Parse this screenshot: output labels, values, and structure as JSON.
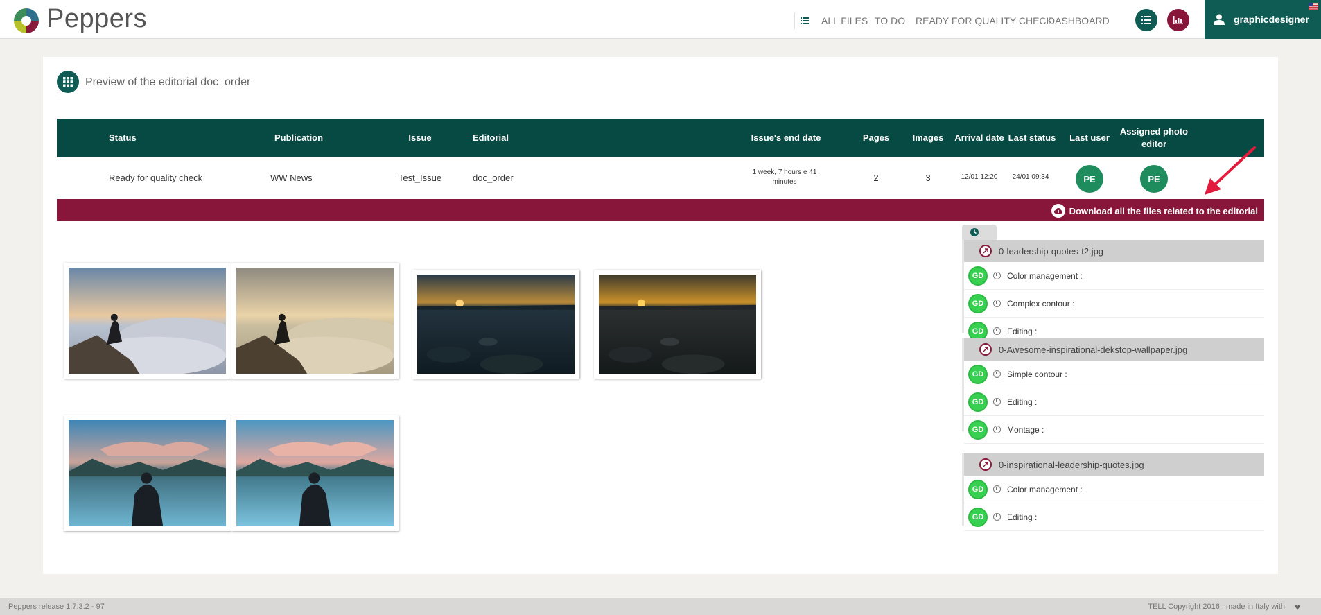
{
  "app": {
    "name": "Peppers"
  },
  "nav": {
    "items": [
      "ALL FILES",
      "TO DO",
      "READY FOR QUALITY CHECK",
      "DASHBOARD"
    ],
    "user": "graphicdesigner"
  },
  "page": {
    "title": "Preview of the editorial doc_order"
  },
  "table": {
    "headers": {
      "status": "Status",
      "publication": "Publication",
      "issue": "Issue",
      "editorial": "Editorial",
      "end_date": "Issue's end date",
      "pages": "Pages",
      "images": "Images",
      "arrival": "Arrival date",
      "last_status": "Last status",
      "last_user": "Last user",
      "assigned_line1": "Assigned photo",
      "assigned_line2": "editor"
    },
    "row": {
      "status": "Ready for quality check",
      "publication": "WW News",
      "issue": "Test_Issue",
      "editorial": "doc_order",
      "end_date_line1": "1 week, 7 hours e 41",
      "end_date_line2": "minutes",
      "pages": "2",
      "images": "3",
      "arrival": "12/01 12:20",
      "last_status": "24/01 09:34",
      "last_user": "PE",
      "assigned": "PE"
    }
  },
  "download": {
    "label": "Download all the files related to the editorial"
  },
  "files": [
    {
      "name": "0-leadership-quotes-t2.jpg",
      "tasks": [
        "Color management :",
        "Complex contour :",
        "Editing :"
      ]
    },
    {
      "name": "0-Awesome-inspirational-dekstop-wallpaper.jpg",
      "tasks": [
        "Simple contour :",
        "Editing :",
        "Montage :"
      ]
    },
    {
      "name": "0-inspirational-leadership-quotes.jpg",
      "tasks": [
        "Color management :",
        "Editing :"
      ]
    }
  ],
  "task_user": "GD",
  "footer": {
    "release": "Peppers release 1.7.3.2 - 97",
    "copyright": "TELL Copyright 2016 : made in Italy with"
  },
  "colors": {
    "brand_green": "#0e5c54",
    "table_header": "#064a43",
    "accent_crimson": "#87163a",
    "user_badge": "#38d050"
  }
}
